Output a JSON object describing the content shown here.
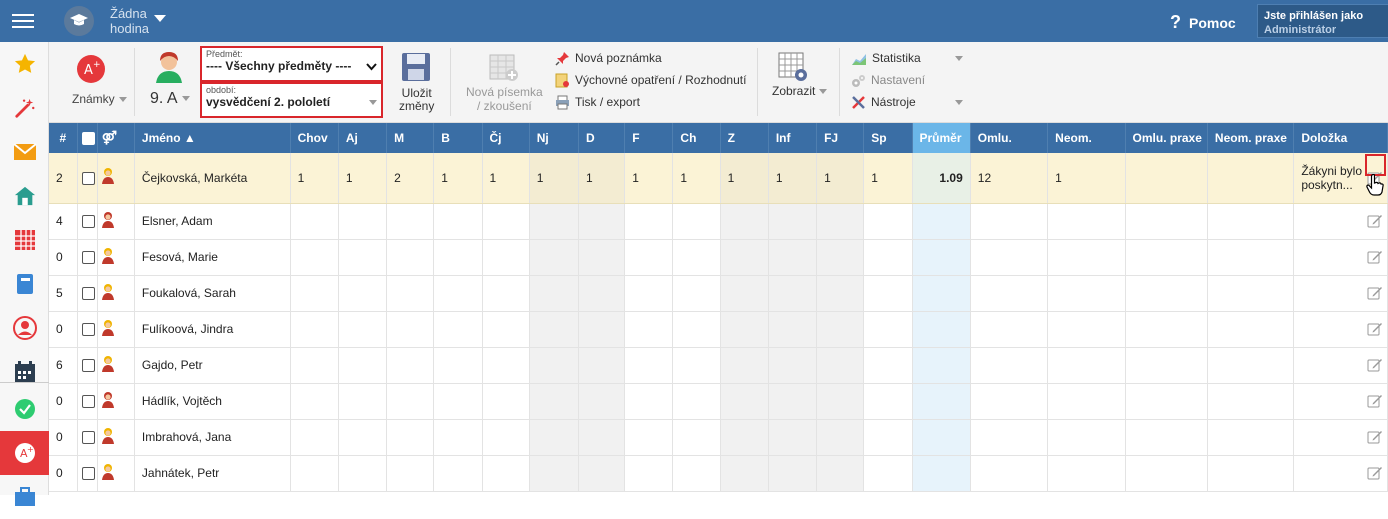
{
  "topbar": {
    "hour_line1": "Žádna",
    "hour_line2": "hodina",
    "help_label": "Pomoc",
    "user_line1": "Jste přihlášen jako",
    "user_line2": "Administrátor"
  },
  "toolbar": {
    "marks_label": "Známky",
    "class_label": "9. A",
    "subject_caption": "Předmět:",
    "subject_value": "---- Všechny předměty ----",
    "period_caption": "období:",
    "period_value": "vysvědčení 2. pololetí",
    "save_line1": "Uložit",
    "save_line2": "změny",
    "new_exam_line1": "Nová písemka",
    "new_exam_line2": "/ zkoušení",
    "new_note": "Nová poznámka",
    "edu_measure": "Výchovné opatření / Rozhodnutí",
    "print_export": "Tisk / export",
    "show_label": "Zobrazit",
    "stats": "Statistika",
    "settings": "Nastavení",
    "tools": "Nástroje"
  },
  "table": {
    "headers": [
      "#",
      "",
      "",
      "Jméno ▲",
      "Chov",
      "Aj",
      "M",
      "B",
      "Čj",
      "Nj",
      "D",
      "F",
      "Ch",
      "Z",
      "Inf",
      "FJ",
      "Sp",
      "Průměr",
      "Omlu.",
      "Neom.",
      "Omlu. praxe",
      "Neom. praxe",
      "Doložka"
    ],
    "gender_symbol": "⚤",
    "rows": [
      {
        "num": "2",
        "name": "Čejkovská, Markéta",
        "gender": "f",
        "grades": [
          "1",
          "1",
          "2",
          "1",
          "1",
          "1",
          "1",
          "1",
          "1",
          "1",
          "1",
          "1",
          "1"
        ],
        "avg": "1.09",
        "omlu": "12",
        "neom": "1",
        "omlu_praxe": "",
        "neom_praxe": "",
        "note": "Žákyni bylo poskytn..."
      },
      {
        "num": "4",
        "name": "Elsner, Adam",
        "gender": "m",
        "grades": [
          "",
          "",
          "",
          "",
          "",
          "",
          "",
          "",
          "",
          "",
          "",
          "",
          ""
        ],
        "avg": "",
        "omlu": "",
        "neom": "",
        "omlu_praxe": "",
        "neom_praxe": "",
        "note": ""
      },
      {
        "num": "0",
        "name": "Fesová, Marie",
        "gender": "f",
        "grades": [
          "",
          "",
          "",
          "",
          "",
          "",
          "",
          "",
          "",
          "",
          "",
          "",
          ""
        ],
        "avg": "",
        "omlu": "",
        "neom": "",
        "omlu_praxe": "",
        "neom_praxe": "",
        "note": ""
      },
      {
        "num": "5",
        "name": "Foukalová, Sarah",
        "gender": "f",
        "grades": [
          "",
          "",
          "",
          "",
          "",
          "",
          "",
          "",
          "",
          "",
          "",
          "",
          ""
        ],
        "avg": "",
        "omlu": "",
        "neom": "",
        "omlu_praxe": "",
        "neom_praxe": "",
        "note": ""
      },
      {
        "num": "0",
        "name": "Fulíkoová, Jindra",
        "gender": "f",
        "grades": [
          "",
          "",
          "",
          "",
          "",
          "",
          "",
          "",
          "",
          "",
          "",
          "",
          ""
        ],
        "avg": "",
        "omlu": "",
        "neom": "",
        "omlu_praxe": "",
        "neom_praxe": "",
        "note": ""
      },
      {
        "num": "6",
        "name": "Gajdo, Petr",
        "gender": "f",
        "grades": [
          "",
          "",
          "",
          "",
          "",
          "",
          "",
          "",
          "",
          "",
          "",
          "",
          ""
        ],
        "avg": "",
        "omlu": "",
        "neom": "",
        "omlu_praxe": "",
        "neom_praxe": "",
        "note": ""
      },
      {
        "num": "0",
        "name": "Hádlík, Vojtěch",
        "gender": "m",
        "grades": [
          "",
          "",
          "",
          "",
          "",
          "",
          "",
          "",
          "",
          "",
          "",
          "",
          ""
        ],
        "avg": "",
        "omlu": "",
        "neom": "",
        "omlu_praxe": "",
        "neom_praxe": "",
        "note": ""
      },
      {
        "num": "0",
        "name": "Imbrahová, Jana",
        "gender": "f",
        "grades": [
          "",
          "",
          "",
          "",
          "",
          "",
          "",
          "",
          "",
          "",
          "",
          "",
          ""
        ],
        "avg": "",
        "omlu": "",
        "neom": "",
        "omlu_praxe": "",
        "neom_praxe": "",
        "note": ""
      },
      {
        "num": "0",
        "name": "Jahnátek, Petr",
        "gender": "f",
        "grades": [
          "",
          "",
          "",
          "",
          "",
          "",
          "",
          "",
          "",
          "",
          "",
          "",
          ""
        ],
        "avg": "",
        "omlu": "",
        "neom": "",
        "omlu_praxe": "",
        "neom_praxe": "",
        "note": ""
      }
    ]
  },
  "colors": {
    "brand": "#3a6ea5",
    "accent_red": "#e5383b",
    "highlight_row": "#fbf3d6",
    "avg_header": "#6bb6e8"
  },
  "icons": {
    "sidebar": [
      "star-icon",
      "magic-wand-icon",
      "mail-icon",
      "home-icon",
      "timetable-icon",
      "notebook-icon",
      "user-circle-icon",
      "calendar-icon",
      "check-icon",
      "grades-icon",
      "briefcase-icon"
    ]
  }
}
